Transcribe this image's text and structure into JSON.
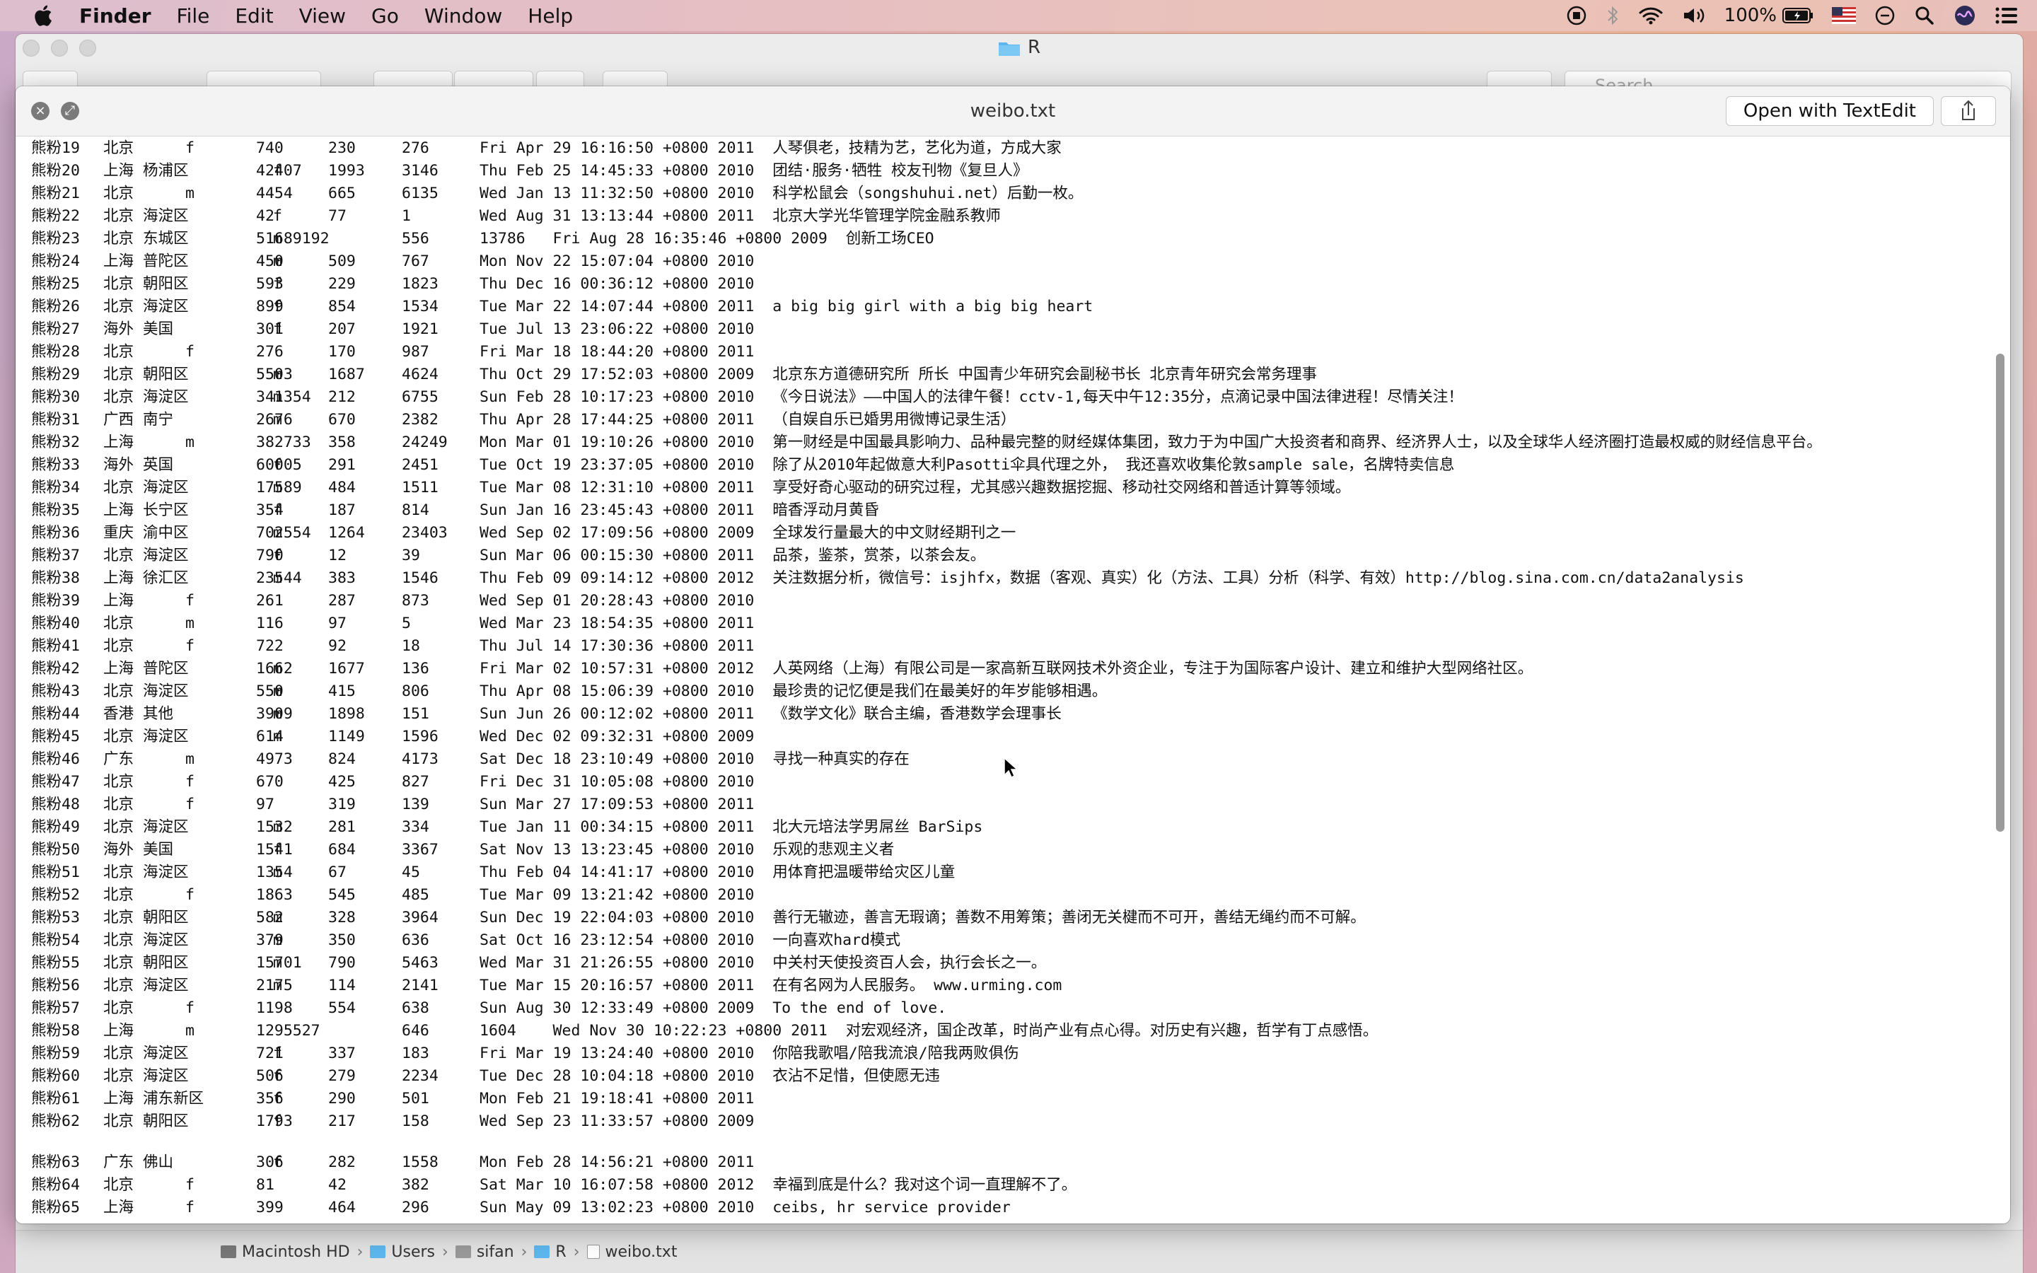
{
  "menubar": {
    "app_name": "Finder",
    "items": [
      "File",
      "Edit",
      "View",
      "Go",
      "Window",
      "Help"
    ],
    "battery": "100%"
  },
  "finder": {
    "title": "R",
    "search_placeholder": "Search",
    "path": [
      "Macintosh HD",
      "Users",
      "sifan",
      "R",
      "weibo.txt"
    ]
  },
  "quicklook": {
    "title": "weibo.txt",
    "open_button": "Open with TextEdit"
  },
  "rows": [
    {
      "a": "熊粉19",
      "b": "北京",
      "c": "f",
      "d": "740",
      "e": "230",
      "f": "276",
      "g": "Fri Apr 29 16:16:50 +0800 2011  人琴俱老，技精为艺，艺化为道，方成大家"
    },
    {
      "a": "熊粉20",
      "b": "上海 杨浦区",
      "c": "f",
      "d": "42407",
      "e": "1993",
      "f": "3146",
      "g": "Thu Feb 25 14:45:33 +0800 2010  团结·服务·牺牲 校友刊物《复旦人》"
    },
    {
      "a": "熊粉21",
      "b": "北京",
      "c": "m",
      "d": "4454",
      "e": "665",
      "f": "6135",
      "g": "Wed Jan 13 11:32:50 +0800 2010  科学松鼠会（songshuhui.net）后勤一枚。"
    },
    {
      "a": "熊粉22",
      "b": "北京 海淀区",
      "c": "f",
      "d": "42",
      "e": "77",
      "f": "1",
      "g": "Wed Aug 31 13:13:44 +0800 2011  北京大学光华管理学院金融系教师"
    },
    {
      "a": "熊粉23",
      "b": "北京 东城区",
      "c": "m",
      "d": "51689192",
      "e": "",
      "f": "556",
      "g": "13786   Fri Aug 28 16:35:46 +0800 2009  创新工场CEO"
    },
    {
      "a": "熊粉24",
      "b": "上海 普陀区",
      "c": "m",
      "d": "450",
      "e": "509",
      "f": "767",
      "g": "Mon Nov 22 15:07:04 +0800 2010"
    },
    {
      "a": "熊粉25",
      "b": "北京 朝阳区",
      "c": "f",
      "d": "593",
      "e": "229",
      "f": "1823",
      "g": "Thu Dec 16 00:36:12 +0800 2010"
    },
    {
      "a": "熊粉26",
      "b": "北京 海淀区",
      "c": "f",
      "d": "899",
      "e": "854",
      "f": "1534",
      "g": "Tue Mar 22 14:07:44 +0800 2011  a big big girl with a big big heart"
    },
    {
      "a": "熊粉27",
      "b": "海外 美国",
      "c": "f",
      "d": "301",
      "e": "207",
      "f": "1921",
      "g": "Tue Jul 13 23:06:22 +0800 2010"
    },
    {
      "a": "熊粉28",
      "b": "北京",
      "c": "f",
      "d": "276",
      "e": "170",
      "f": "987",
      "g": "Fri Mar 18 18:44:20 +0800 2011"
    },
    {
      "a": "熊粉29",
      "b": "北京 朝阳区",
      "c": "m",
      "d": "5503",
      "e": "1687",
      "f": "4624",
      "g": "Thu Oct 29 17:52:03 +0800 2009  北京东方道德研究所 所长 中国青少年研究会副秘书长 北京青年研究会常务理事"
    },
    {
      "a": "熊粉30",
      "b": "北京 海淀区",
      "c": "m",
      "d": "341354",
      "e": "212",
      "f": "6755",
      "g": "Sun Feb 28 10:17:23 +0800 2010  《今日说法》——中国人的法律午餐！cctv-1,每天中午12:35分，点滴记录中国法律进程！尽情关注！"
    },
    {
      "a": "熊粉31",
      "b": "广西 南宁",
      "c": "m",
      "d": "2676",
      "e": "670",
      "f": "2382",
      "g": "Thu Apr 28 17:44:25 +0800 2011  （自娱自乐已婚男用微博记录生活）"
    },
    {
      "a": "熊粉32",
      "b": "上海",
      "c": "m",
      "d": "382733",
      "e": "358",
      "f": "24249",
      "g": "Mon Mar 01 19:10:26 +0800 2010  第一财经是中国最具影响力、品种最完整的财经媒体集团，致力于为中国广大投资者和商界、经济界人士，以及全球华人经济圈打造最权威的财经信息平台。"
    },
    {
      "a": "熊粉33",
      "b": "海外 英国",
      "c": "f",
      "d": "60005",
      "e": "291",
      "f": "2451",
      "g": "Tue Oct 19 23:37:05 +0800 2010  除了从2010年起做意大利Pasotti伞具代理之外， 我还喜欢收集伦敦sample sale，名牌特卖信息"
    },
    {
      "a": "熊粉34",
      "b": "北京 海淀区",
      "c": "m",
      "d": "17589",
      "e": "484",
      "f": "1511",
      "g": "Tue Mar 08 12:31:10 +0800 2011  享受好奇心驱动的研究过程，尤其感兴趣数据挖掘、移动社交网络和普适计算等领域。"
    },
    {
      "a": "熊粉35",
      "b": "上海 长宁区",
      "c": "f",
      "d": "354",
      "e": "187",
      "f": "814",
      "g": "Sun Jan 16 23:45:43 +0800 2011  暗香浮动月黄昏"
    },
    {
      "a": "熊粉36",
      "b": "重庆 渝中区",
      "c": "m",
      "d": "702554",
      "e": "1264",
      "f": "23403",
      "g": "Wed Sep 02 17:09:56 +0800 2009  全球发行量最大的中文财经期刊之一"
    },
    {
      "a": "熊粉37",
      "b": "北京 海淀区",
      "c": "f",
      "d": "790",
      "e": "12",
      "f": "39",
      "g": "Sun Mar 06 00:15:30 +0800 2011  品茶，鉴茶，赏茶，以茶会友。"
    },
    {
      "a": "熊粉38",
      "b": "上海 徐汇区",
      "c": "m",
      "d": "23544",
      "e": "383",
      "f": "1546",
      "g": "Thu Feb 09 09:14:12 +0800 2012  关注数据分析，微信号：isjhfx，数据（客观、真实）化（方法、工具）分析（科学、有效）http://blog.sina.com.cn/data2analysis"
    },
    {
      "a": "熊粉39",
      "b": "上海",
      "c": "f",
      "d": "261",
      "e": "287",
      "f": "873",
      "g": "Wed Sep 01 20:28:43 +0800 2010"
    },
    {
      "a": "熊粉40",
      "b": "北京",
      "c": "m",
      "d": "116",
      "e": "97",
      "f": "5",
      "g": "Wed Mar 23 18:54:35 +0800 2011"
    },
    {
      "a": "熊粉41",
      "b": "北京",
      "c": "f",
      "d": "722",
      "e": "92",
      "f": "18",
      "g": "Thu Jul 14 17:30:36 +0800 2011"
    },
    {
      "a": "熊粉42",
      "b": "上海 普陀区",
      "c": "m",
      "d": "1662",
      "e": "1677",
      "f": "136",
      "g": "Fri Mar 02 10:57:31 +0800 2012  人英网络（上海）有限公司是一家高新互联网技术外资企业，专注于为国际客户设计、建立和维护大型网络社区。"
    },
    {
      "a": "熊粉43",
      "b": "北京 海淀区",
      "c": "m",
      "d": "550",
      "e": "415",
      "f": "806",
      "g": "Thu Apr 08 15:06:39 +0800 2010  最珍贵的记忆便是我们在最美好的年岁能够相遇。"
    },
    {
      "a": "熊粉44",
      "b": "香港 其他",
      "c": "m",
      "d": "3909",
      "e": "1898",
      "f": "151",
      "g": "Sun Jun 26 00:12:02 +0800 2011  《数学文化》联合主编，香港数学会理事长"
    },
    {
      "a": "熊粉45",
      "b": "北京 海淀区",
      "c": "m",
      "d": "614",
      "e": "1149",
      "f": "1596",
      "g": "Wed Dec 02 09:32:31 +0800 2009"
    },
    {
      "a": "熊粉46",
      "b": "广东",
      "c": "m",
      "d": "4973",
      "e": "824",
      "f": "4173",
      "g": "Sat Dec 18 23:10:49 +0800 2010  寻找一种真实的存在"
    },
    {
      "a": "熊粉47",
      "b": "北京",
      "c": "f",
      "d": "670",
      "e": "425",
      "f": "827",
      "g": "Fri Dec 31 10:05:08 +0800 2010"
    },
    {
      "a": "熊粉48",
      "b": "北京",
      "c": "f",
      "d": "97",
      "e": "319",
      "f": "139",
      "g": "Sun Mar 27 17:09:53 +0800 2011"
    },
    {
      "a": "熊粉49",
      "b": "北京 海淀区",
      "c": "m",
      "d": "1532",
      "e": "281",
      "f": "334",
      "g": "Tue Jan 11 00:34:15 +0800 2011  北大元培法学男屌丝 BarSips"
    },
    {
      "a": "熊粉50",
      "b": "海外 美国",
      "c": "f",
      "d": "1541",
      "e": "684",
      "f": "3367",
      "g": "Sat Nov 13 13:23:45 +0800 2010  乐观的悲观主义者"
    },
    {
      "a": "熊粉51",
      "b": "北京 海淀区",
      "c": "m",
      "d": "1354",
      "e": "67",
      "f": "45",
      "g": "Thu Feb 04 14:41:17 +0800 2010  用体育把温暖带给灾区儿童"
    },
    {
      "a": "熊粉52",
      "b": "北京",
      "c": "f",
      "d": "1863",
      "e": "545",
      "f": "485",
      "g": "Tue Mar 09 13:21:42 +0800 2010"
    },
    {
      "a": "熊粉53",
      "b": "北京 朝阳区",
      "c": "m",
      "d": "582",
      "e": "328",
      "f": "3964",
      "g": "Sun Dec 19 22:04:03 +0800 2010  善行无辙迹，善言无瑕谪；善数不用筹策；善闭无关楗而不可开，善结无绳约而不可解。"
    },
    {
      "a": "熊粉54",
      "b": "北京 海淀区",
      "c": "m",
      "d": "379",
      "e": "350",
      "f": "636",
      "g": "Sat Oct 16 23:12:54 +0800 2010  一向喜欢hard模式"
    },
    {
      "a": "熊粉55",
      "b": "北京 朝阳区",
      "c": "m",
      "d": "15701",
      "e": "790",
      "f": "5463",
      "g": "Wed Mar 31 21:26:55 +0800 2010  中关村天使投资百人会，执行会长之一。"
    },
    {
      "a": "熊粉56",
      "b": "北京 海淀区",
      "c": "m",
      "d": "2175",
      "e": "114",
      "f": "2141",
      "g": "Tue Mar 15 20:16:57 +0800 2011  在有名网为人民服务。 www.urming.com"
    },
    {
      "a": "熊粉57",
      "b": "北京",
      "c": "f",
      "d": "1198",
      "e": "554",
      "f": "638",
      "g": "Sun Aug 30 12:33:49 +0800 2009  To the end of love."
    },
    {
      "a": "熊粉58",
      "b": "上海",
      "c": "m",
      "d": "1295527",
      "e": "",
      "f": "646",
      "g": "1604    Wed Nov 30 10:22:23 +0800 2011  对宏观经济，国企改革，时尚产业有点心得。对历史有兴趣，哲学有丁点感悟。"
    },
    {
      "a": "熊粉59",
      "b": "北京 海淀区",
      "c": "f",
      "d": "721",
      "e": "337",
      "f": "183",
      "g": "Fri Mar 19 13:24:40 +0800 2010  你陪我歌唱/陪我流浪/陪我两败俱伤"
    },
    {
      "a": "熊粉60",
      "b": "北京 海淀区",
      "c": "f",
      "d": "506",
      "e": "279",
      "f": "2234",
      "g": "Tue Dec 28 10:04:18 +0800 2010  衣沾不足惜，但使愿无违"
    },
    {
      "a": "熊粉61",
      "b": "上海 浦东新区",
      "c": "f",
      "d": "356",
      "e": "290",
      "f": "501",
      "g": "Mon Feb 21 19:18:41 +0800 2011"
    },
    {
      "a": "熊粉62",
      "b": "北京 朝阳区",
      "c": "f",
      "d": "1793",
      "e": "217",
      "f": "158",
      "g": "Wed Sep 23 11:33:57 +0800 2009"
    },
    {
      "a": "熊粉63",
      "b": "广东 佛山",
      "c": "f",
      "d": "306",
      "e": "282",
      "f": "1558",
      "g": "Mon Feb 28 14:56:21 +0800 2011"
    },
    {
      "a": "熊粉64",
      "b": "北京",
      "c": "f",
      "d": "81",
      "e": "42",
      "f": "382",
      "g": "Sat Mar 10 16:07:58 +0800 2012  幸福到底是什么？我对这个词一直理解不了。"
    },
    {
      "a": "熊粉65",
      "b": "上海",
      "c": "f",
      "d": "399",
      "e": "464",
      "f": "296",
      "g": "Sun May 09 13:02:23 +0800 2010  ceibs, hr service provider"
    }
  ]
}
